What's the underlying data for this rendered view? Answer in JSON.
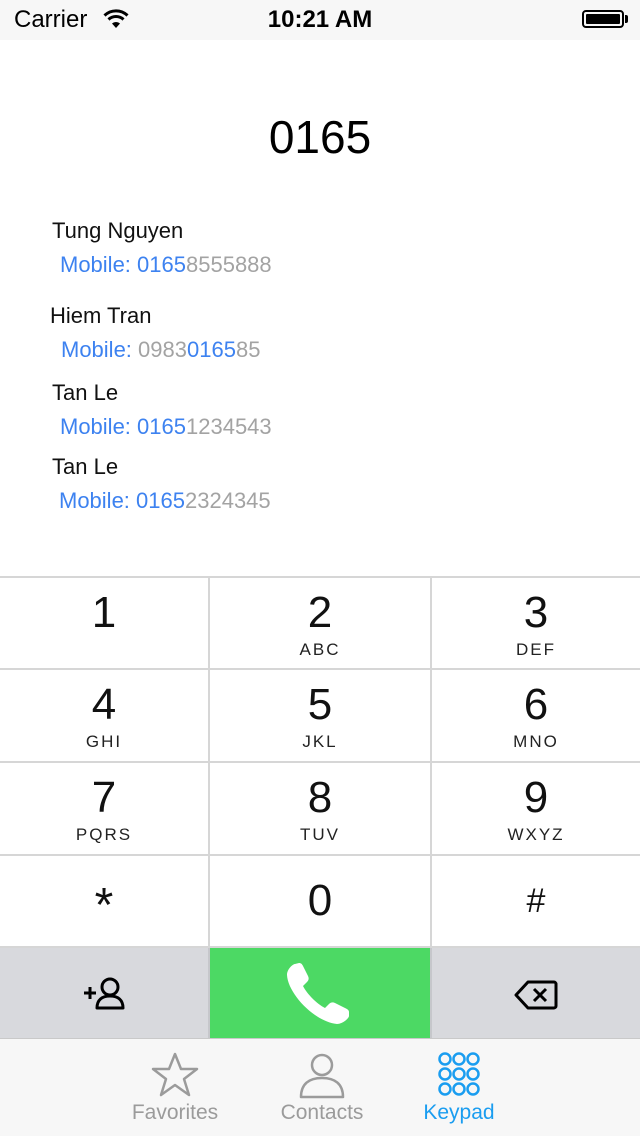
{
  "status_bar": {
    "carrier": "Carrier",
    "time": "10:21 AM"
  },
  "dialed_number": "0165",
  "suggestions": [
    {
      "name": "Tung Nguyen",
      "label": "Mobile:",
      "pre": "",
      "match": "0165",
      "post": "8555888"
    },
    {
      "name": "Hiem Tran",
      "label": "Mobile:",
      "pre": "0983",
      "match": "0165",
      "post": "85"
    },
    {
      "name": "Tan Le",
      "label": "Mobile:",
      "pre": "",
      "match": "0165",
      "post": "1234543"
    },
    {
      "name": "Tan Le",
      "label": "Mobile:",
      "pre": "",
      "match": "0165",
      "post": "2324345"
    }
  ],
  "keys": [
    {
      "digit": "1",
      "letters": ""
    },
    {
      "digit": "2",
      "letters": "ABC"
    },
    {
      "digit": "3",
      "letters": "DEF"
    },
    {
      "digit": "4",
      "letters": "GHI"
    },
    {
      "digit": "5",
      "letters": "JKL"
    },
    {
      "digit": "6",
      "letters": "MNO"
    },
    {
      "digit": "7",
      "letters": "PQRS"
    },
    {
      "digit": "8",
      "letters": "TUV"
    },
    {
      "digit": "9",
      "letters": "WXYZ"
    },
    {
      "digit": "*",
      "letters": ""
    },
    {
      "digit": "0",
      "letters": ""
    },
    {
      "digit": "#",
      "letters": ""
    }
  ],
  "actions": {
    "add_contact_icon": "add-contact-icon",
    "call_icon": "phone-icon",
    "delete_icon": "backspace-icon"
  },
  "tabs": [
    {
      "label": "Favorites",
      "icon": "star-icon",
      "active": false
    },
    {
      "label": "Contacts",
      "icon": "person-icon",
      "active": false
    },
    {
      "label": "Keypad",
      "icon": "keypad-grid-icon",
      "active": true
    }
  ],
  "colors": {
    "accent": "#1a9df0",
    "match_blue": "#3d82f0",
    "call_green": "#4cd964",
    "muted_gray": "#a3a3a3"
  }
}
